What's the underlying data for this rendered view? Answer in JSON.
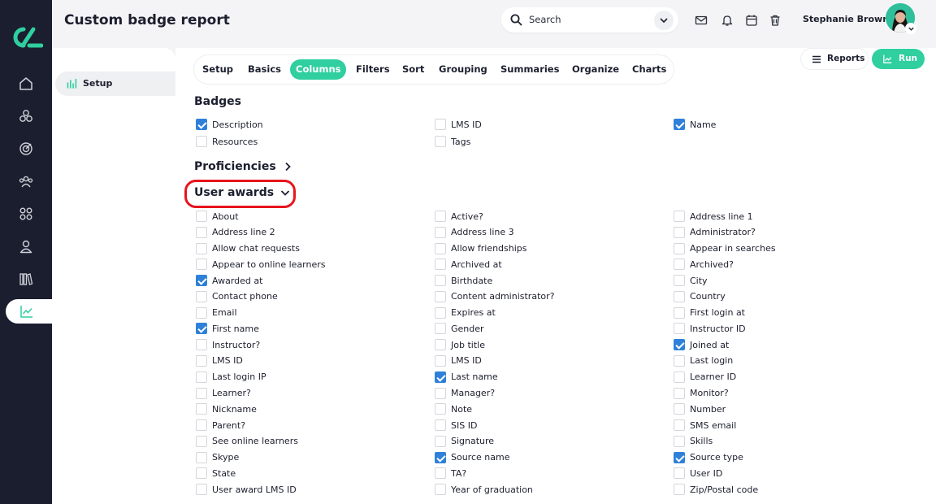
{
  "header": {
    "title": "Custom badge report",
    "search_label": "Search",
    "user_name": "Stephanie Brown"
  },
  "nav": {
    "icons": [
      "logo-icon",
      "home-icon",
      "cubes-icon",
      "target-icon",
      "users-icon",
      "apps-icon",
      "user-icon",
      "library-icon",
      "chart-icon"
    ]
  },
  "setup_panel": {
    "item_label": "Setup"
  },
  "tabs": [
    {
      "label": "Setup",
      "active": false
    },
    {
      "label": "Basics",
      "active": false
    },
    {
      "label": "Columns",
      "active": true
    },
    {
      "label": "Filters",
      "active": false
    },
    {
      "label": "Sort",
      "active": false
    },
    {
      "label": "Grouping",
      "active": false
    },
    {
      "label": "Summaries",
      "active": false
    },
    {
      "label": "Organize",
      "active": false
    },
    {
      "label": "Charts",
      "active": false
    }
  ],
  "actions": {
    "reports_label": "Reports",
    "run_label": "Run"
  },
  "colors": {
    "accent": "#2fcfa0",
    "checkbox": "#2f80d8",
    "highlight": "#e8141c",
    "sidebar": "#1b1e2e"
  },
  "sections": {
    "badges": {
      "title": "Badges",
      "items": [
        {
          "label": "Description",
          "checked": true
        },
        {
          "label": "LMS ID",
          "checked": false
        },
        {
          "label": "Name",
          "checked": true
        },
        {
          "label": "Resources",
          "checked": false
        },
        {
          "label": "Tags",
          "checked": false
        }
      ]
    },
    "proficiencies": {
      "title": "Proficiencies"
    },
    "user_awards": {
      "title": "User awards",
      "items": [
        {
          "label": "About",
          "checked": false
        },
        {
          "label": "Active?",
          "checked": false
        },
        {
          "label": "Address line 1",
          "checked": false
        },
        {
          "label": "Address line 2",
          "checked": false
        },
        {
          "label": "Address line 3",
          "checked": false
        },
        {
          "label": "Administrator?",
          "checked": false
        },
        {
          "label": "Allow chat requests",
          "checked": false
        },
        {
          "label": "Allow friendships",
          "checked": false
        },
        {
          "label": "Appear in searches",
          "checked": false
        },
        {
          "label": "Appear to online learners",
          "checked": false
        },
        {
          "label": "Archived at",
          "checked": false
        },
        {
          "label": "Archived?",
          "checked": false
        },
        {
          "label": "Awarded at",
          "checked": true
        },
        {
          "label": "Birthdate",
          "checked": false
        },
        {
          "label": "City",
          "checked": false
        },
        {
          "label": "Contact phone",
          "checked": false
        },
        {
          "label": "Content administrator?",
          "checked": false
        },
        {
          "label": "Country",
          "checked": false
        },
        {
          "label": "Email",
          "checked": false
        },
        {
          "label": "Expires at",
          "checked": false
        },
        {
          "label": "First login at",
          "checked": false
        },
        {
          "label": "First name",
          "checked": true
        },
        {
          "label": "Gender",
          "checked": false
        },
        {
          "label": "Instructor ID",
          "checked": false
        },
        {
          "label": "Instructor?",
          "checked": false
        },
        {
          "label": "Job title",
          "checked": false
        },
        {
          "label": "Joined at",
          "checked": true
        },
        {
          "label": "LMS ID",
          "checked": false
        },
        {
          "label": "LMS ID",
          "checked": false
        },
        {
          "label": "Last login",
          "checked": false
        },
        {
          "label": "Last login IP",
          "checked": false
        },
        {
          "label": "Last name",
          "checked": true
        },
        {
          "label": "Learner ID",
          "checked": false
        },
        {
          "label": "Learner?",
          "checked": false
        },
        {
          "label": "Manager?",
          "checked": false
        },
        {
          "label": "Monitor?",
          "checked": false
        },
        {
          "label": "Nickname",
          "checked": false
        },
        {
          "label": "Note",
          "checked": false
        },
        {
          "label": "Number",
          "checked": false
        },
        {
          "label": "Parent?",
          "checked": false
        },
        {
          "label": "SIS ID",
          "checked": false
        },
        {
          "label": "SMS email",
          "checked": false
        },
        {
          "label": "See online learners",
          "checked": false
        },
        {
          "label": "Signature",
          "checked": false
        },
        {
          "label": "Skills",
          "checked": false
        },
        {
          "label": "Skype",
          "checked": false
        },
        {
          "label": "Source name",
          "checked": true
        },
        {
          "label": "Source type",
          "checked": true
        },
        {
          "label": "State",
          "checked": false
        },
        {
          "label": "TA?",
          "checked": false
        },
        {
          "label": "User ID",
          "checked": false
        },
        {
          "label": "User award LMS ID",
          "checked": false
        },
        {
          "label": "Year of graduation",
          "checked": false
        },
        {
          "label": "Zip/Postal code",
          "checked": false
        }
      ]
    }
  }
}
